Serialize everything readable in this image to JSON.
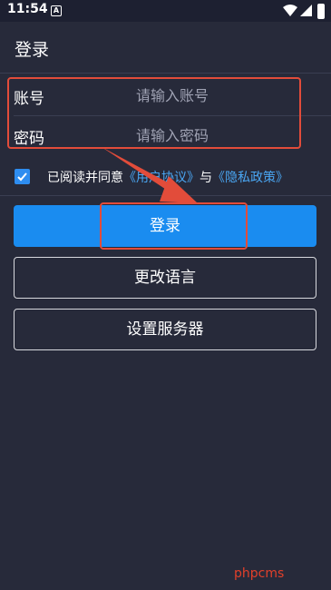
{
  "status_bar": {
    "time": "11:54",
    "notification_icon": "A"
  },
  "page": {
    "title": "登录"
  },
  "form": {
    "account_label": "账号",
    "account_placeholder": "请输入账号",
    "password_label": "密码",
    "password_placeholder": "请输入密码"
  },
  "agreement": {
    "checked": true,
    "prefix": "已阅读并同意",
    "user_agreement": "《用户协议》",
    "connector": "与",
    "privacy_policy": "《隐私政策》"
  },
  "buttons": {
    "login": "登录",
    "change_language": "更改语言",
    "set_server": "设置服务器"
  },
  "watermark": "phpcms",
  "colors": {
    "background": "#272a3a",
    "primary": "#1a8cf0",
    "link": "#4aa6f2",
    "annotation": "#e24c3a"
  }
}
